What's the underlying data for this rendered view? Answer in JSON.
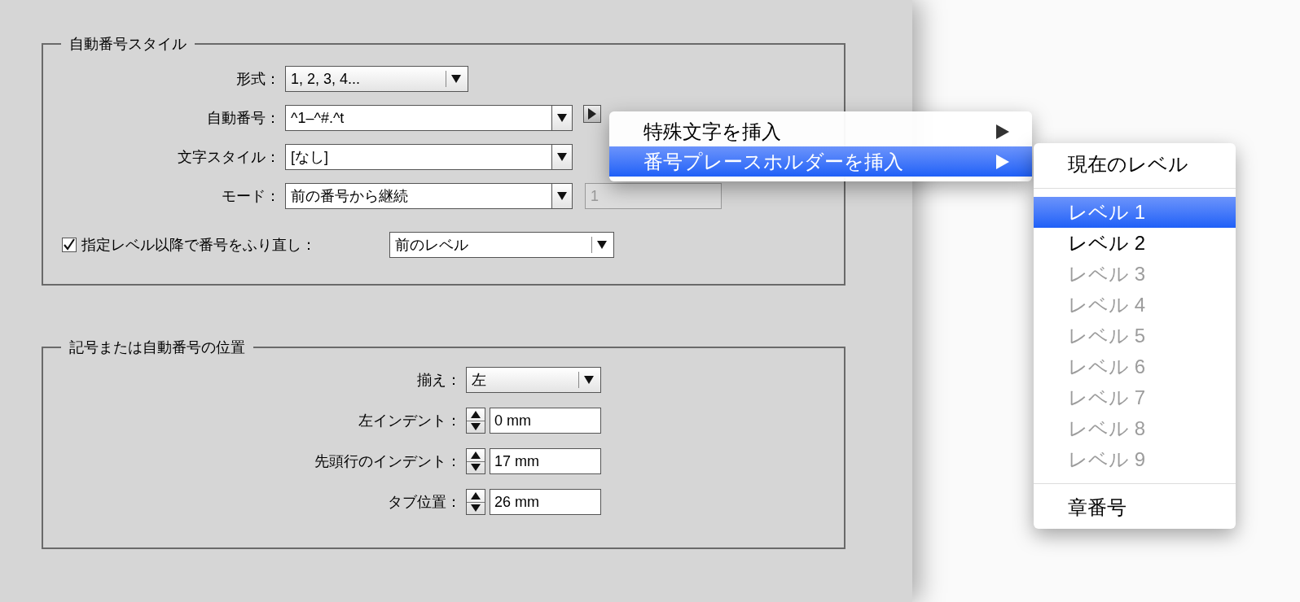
{
  "numbering_style": {
    "title": "自動番号スタイル",
    "rows": [
      {
        "kind": "select",
        "label": "形式：",
        "value": "1, 2, 3, 4..."
      },
      {
        "kind": "combo",
        "label": "自動番号：",
        "value": "^1–^#.^t",
        "has_menu": true
      },
      {
        "kind": "combo",
        "label": "文字スタイル：",
        "value": "[なし]"
      },
      {
        "kind": "combo",
        "label": "モード：",
        "value": "前の番号から継続",
        "extra_field": {
          "value": "1",
          "disabled": true
        }
      }
    ],
    "restart": {
      "checked": true,
      "label": "指定レベル以降で番号をふり直し：",
      "value": "前のレベル"
    }
  },
  "position": {
    "title": "記号または自動番号の位置",
    "rows": [
      {
        "kind": "select",
        "label": "揃え：",
        "value": "左"
      },
      {
        "kind": "stepper",
        "label": "左インデント：",
        "value": "0 mm"
      },
      {
        "kind": "stepper",
        "label": "先頭行のインデント：",
        "value": "17 mm"
      },
      {
        "kind": "stepper",
        "label": "タブ位置：",
        "value": "26 mm"
      }
    ]
  },
  "context_menu": {
    "items": [
      {
        "label": "特殊文字を挿入",
        "selected": false,
        "submenu": true
      },
      {
        "label": "番号プレースホルダーを挿入",
        "selected": true,
        "submenu": true
      }
    ]
  },
  "submenu": {
    "items": [
      {
        "kind": "item",
        "label": "現在のレベル",
        "selected": false,
        "disabled": false
      },
      {
        "kind": "separator"
      },
      {
        "kind": "item",
        "label": "レベル 1",
        "selected": true,
        "disabled": false
      },
      {
        "kind": "item",
        "label": "レベル 2",
        "selected": false,
        "disabled": false
      },
      {
        "kind": "item",
        "label": "レベル 3",
        "selected": false,
        "disabled": true
      },
      {
        "kind": "item",
        "label": "レベル 4",
        "selected": false,
        "disabled": true
      },
      {
        "kind": "item",
        "label": "レベル 5",
        "selected": false,
        "disabled": true
      },
      {
        "kind": "item",
        "label": "レベル 6",
        "selected": false,
        "disabled": true
      },
      {
        "kind": "item",
        "label": "レベル 7",
        "selected": false,
        "disabled": true
      },
      {
        "kind": "item",
        "label": "レベル 8",
        "selected": false,
        "disabled": true
      },
      {
        "kind": "item",
        "label": "レベル 9",
        "selected": false,
        "disabled": true
      },
      {
        "kind": "separator"
      },
      {
        "kind": "item",
        "label": "章番号",
        "selected": false,
        "disabled": false
      }
    ]
  }
}
